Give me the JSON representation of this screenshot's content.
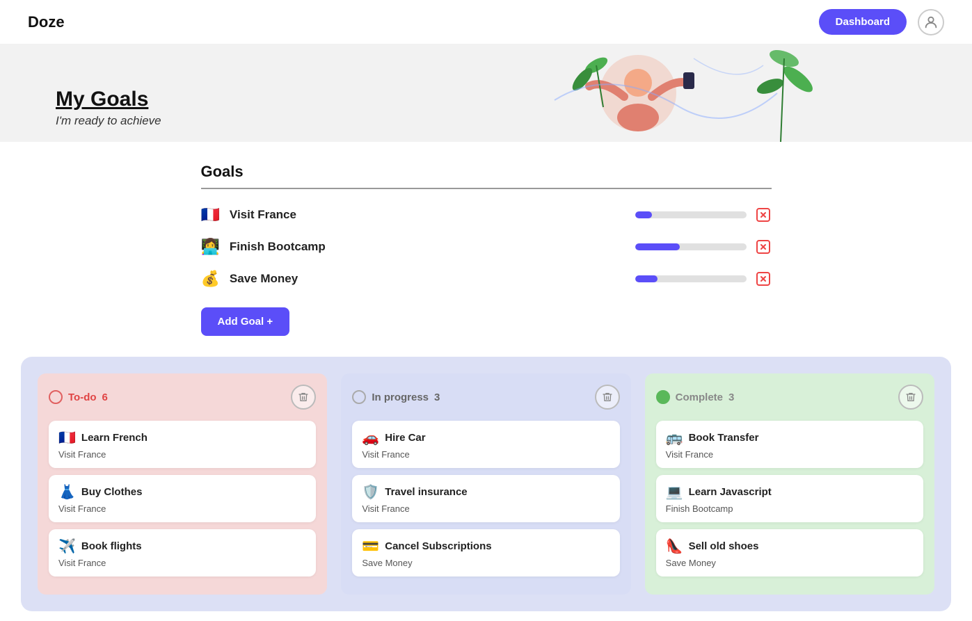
{
  "nav": {
    "logo": "Doze",
    "dashboard_btn": "Dashboard"
  },
  "hero": {
    "title": "My Goals",
    "subtitle": "I'm ready to achieve"
  },
  "goals_heading": "Goals",
  "goals": [
    {
      "id": "visit-france",
      "emoji": "🇫🇷",
      "label": "Visit France",
      "progress": 15
    },
    {
      "id": "finish-bootcamp",
      "emoji": "👩‍💻",
      "label": "Finish Bootcamp",
      "progress": 40
    },
    {
      "id": "save-money",
      "emoji": "💰",
      "label": "Save Money",
      "progress": 20
    }
  ],
  "add_goal_btn": "Add Goal +",
  "columns": [
    {
      "id": "todo",
      "title": "To-do",
      "count": "6",
      "dot_style": "dot-todo",
      "title_style": "col-title-todo",
      "col_style": "col-todo",
      "tasks": [
        {
          "icon": "🇫🇷",
          "title": "Learn French",
          "sub": "Visit France"
        },
        {
          "icon": "👗",
          "title": "Buy Clothes",
          "sub": "Visit France"
        },
        {
          "icon": "✈️",
          "title": "Book flights",
          "sub": "Visit France"
        }
      ]
    },
    {
      "id": "inprogress",
      "title": "In progress",
      "count": "3",
      "dot_style": "dot-inprogress",
      "title_style": "col-title-inprogress",
      "col_style": "col-inprogress",
      "tasks": [
        {
          "icon": "🚗",
          "title": "Hire Car",
          "sub": "Visit France"
        },
        {
          "icon": "🛡️",
          "title": "Travel insurance",
          "sub": "Visit France"
        },
        {
          "icon": "💳",
          "title": "Cancel Subscriptions",
          "sub": "Save Money"
        }
      ]
    },
    {
      "id": "complete",
      "title": "Complete",
      "count": "3",
      "dot_style": "dot-complete",
      "title_style": "col-title-complete",
      "col_style": "col-complete",
      "tasks": [
        {
          "icon": "🚌",
          "title": "Book Transfer",
          "sub": "Visit France"
        },
        {
          "icon": "💻",
          "title": "Learn Javascript",
          "sub": "Finish Bootcamp"
        },
        {
          "icon": "👠",
          "title": "Sell old shoes",
          "sub": "Save Money"
        }
      ]
    }
  ]
}
